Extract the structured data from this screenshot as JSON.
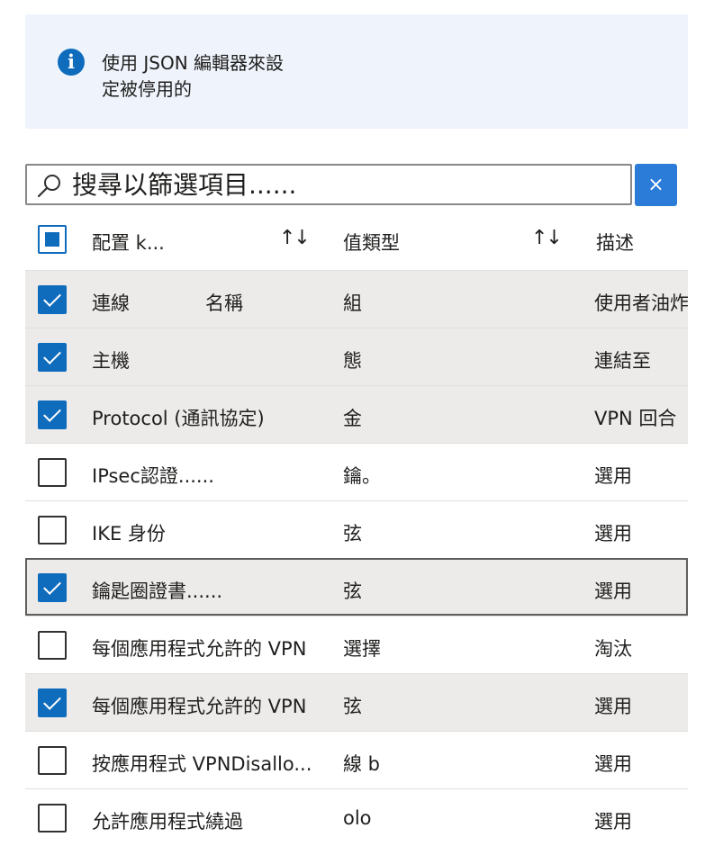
{
  "banner": {
    "icon": "info-icon",
    "text_line1": "使用 JSON 編輯器來設",
    "text_line2": "定被停用的"
  },
  "search": {
    "placeholder": "搜尋以篩選項目......",
    "icon": "search-icon"
  },
  "clear_button": {
    "label": "×",
    "icon": "close-icon"
  },
  "table": {
    "header": {
      "select_all": "partial",
      "columns": [
        {
          "label": "配置 k...",
          "sort_icon": "↑↓"
        },
        {
          "label": "值類型",
          "sort_icon": "↑↓"
        },
        {
          "label": "描述"
        }
      ]
    },
    "rows": [
      {
        "checked": true,
        "name": "連線　　　　名稱",
        "type": "組",
        "desc": "使用者油炸鍋"
      },
      {
        "checked": true,
        "name": "主機",
        "type": "態",
        "desc": "連結至"
      },
      {
        "checked": true,
        "name": "Protocol (通訊協定)",
        "type": "金",
        "desc": "VPN 回合"
      },
      {
        "checked": false,
        "name": "IPsec認證......",
        "type": "鑰。",
        "desc": "選用"
      },
      {
        "checked": false,
        "name": "IKE 身份",
        "type": "弦",
        "desc": "選用"
      },
      {
        "checked": true,
        "name": "鑰匙圈證書......",
        "type": "弦",
        "desc": "選用",
        "focused": true
      },
      {
        "checked": false,
        "name": "每個應用程式允許的 VPN",
        "type": "選擇",
        "desc": "淘汰"
      },
      {
        "checked": true,
        "name": "每個應用程式允許的 VPN",
        "type": "弦",
        "desc": "選用"
      },
      {
        "checked": false,
        "name": "按應用程式 VPNDisallo...",
        "type": "線 b",
        "desc": "選用"
      },
      {
        "checked": false,
        "name": "允許應用程式繞過",
        "type": "olo",
        "desc": "選用"
      }
    ]
  }
}
